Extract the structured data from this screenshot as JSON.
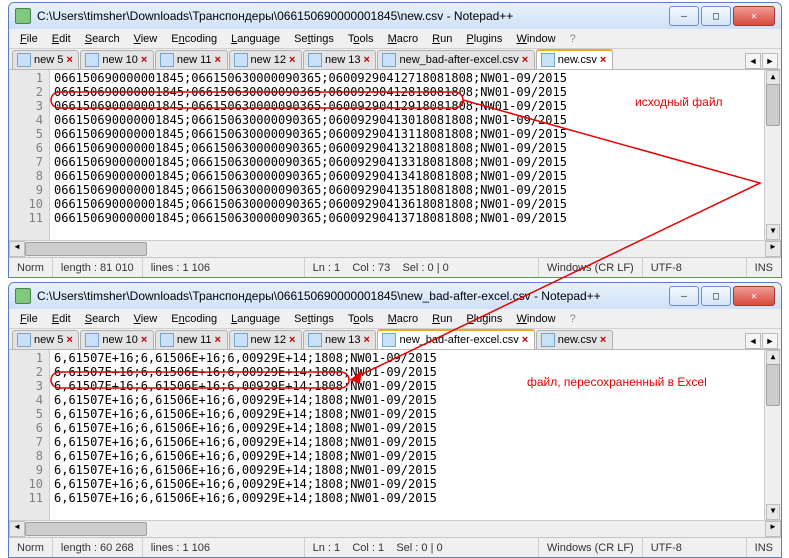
{
  "tabs": [
    {
      "label": "new 5"
    },
    {
      "label": "new 10"
    },
    {
      "label": "new 11"
    },
    {
      "label": "new 12"
    },
    {
      "label": "new 13"
    },
    {
      "label": "new_bad-after-excel.csv"
    },
    {
      "label": "new.csv"
    }
  ],
  "menu": {
    "file": "File",
    "edit": "Edit",
    "search": "Search",
    "view": "View",
    "encoding": "Encoding",
    "language": "Language",
    "settings": "Settings",
    "tools": "Tools",
    "macro": "Macro",
    "run": "Run",
    "plugins": "Plugins",
    "window": "Window",
    "help": "?"
  },
  "win1": {
    "title": "C:\\Users\\timsher\\Downloads\\Транспондеры\\066150690000001845\\new.csv - Notepad++",
    "active_tab": 6,
    "lines": [
      "066150690000001845;066150630000090365;06009290412718081808;NW01-09/2015",
      "066150690000001845;066150630000090365;06009290412818081808;NW01-09/2015",
      "066150690000001845;066150630000090365;06009290412918081808;NW01-09/2015",
      "066150690000001845;066150630000090365;06009290413018081808;NW01-09/2015",
      "066150690000001845;066150630000090365;06009290413118081808;NW01-09/2015",
      "066150690000001845;066150630000090365;06009290413218081808;NW01-09/2015",
      "066150690000001845;066150630000090365;06009290413318081808;NW01-09/2015",
      "066150690000001845;066150630000090365;06009290413418081808;NW01-09/2015",
      "066150690000001845;066150630000090365;06009290413518081808;NW01-09/2015",
      "066150690000001845;066150630000090365;06009290413618081808;NW01-09/2015",
      "066150690000001845;066150630000090365;06009290413718081808;NW01-09/2015"
    ],
    "status": {
      "norm": "Norm",
      "length": "length : 81 010",
      "lines": "lines : 1 106",
      "pos": "Ln : 1    Col : 73    Sel : 0 | 0",
      "eol": "Windows (CR LF)",
      "enc": "UTF-8",
      "ins": "INS"
    }
  },
  "win2": {
    "title": "C:\\Users\\timsher\\Downloads\\Транспондеры\\066150690000001845\\new_bad-after-excel.csv - Notepad++",
    "active_tab": 5,
    "lines": [
      "6,61507E+16;6,61506E+16;6,00929E+14;1808;NW01-09/2015",
      "6,61507E+16;6,61506E+16;6,00929E+14;1808;NW01-09/2015",
      "6,61507E+16;6,61506E+16;6,00929E+14;1808;NW01-09/2015",
      "6,61507E+16;6,61506E+16;6,00929E+14;1808;NW01-09/2015",
      "6,61507E+16;6,61506E+16;6,00929E+14;1808;NW01-09/2015",
      "6,61507E+16;6,61506E+16;6,00929E+14;1808;NW01-09/2015",
      "6,61507E+16;6,61506E+16;6,00929E+14;1808;NW01-09/2015",
      "6,61507E+16;6,61506E+16;6,00929E+14;1808;NW01-09/2015",
      "6,61507E+16;6,61506E+16;6,00929E+14;1808;NW01-09/2015",
      "6,61507E+16;6,61506E+16;6,00929E+14;1808;NW01-09/2015",
      "6,61507E+16;6,61506E+16;6,00929E+14;1808;NW01-09/2015"
    ],
    "status": {
      "norm": "Norm",
      "length": "length : 60 268",
      "lines": "lines : 1 106",
      "pos": "Ln : 1    Col : 1    Sel : 0 | 0",
      "eol": "Windows (CR LF)",
      "enc": "UTF-8",
      "ins": "INS"
    }
  },
  "annotations": {
    "a1": "исходный файл",
    "a2": "файл, пересохраненный в Excel"
  }
}
